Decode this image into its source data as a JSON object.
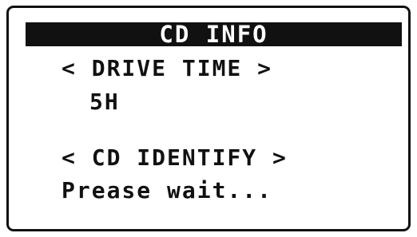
{
  "screen": {
    "title": "CD INFO",
    "drive_time_label": "< DRIVE TIME >",
    "drive_time_value": "5H",
    "identify_label": "< CD IDENTIFY >",
    "status": "Prease wait..."
  },
  "colors": {
    "foreground": "#111111",
    "background": "#ffffff"
  }
}
